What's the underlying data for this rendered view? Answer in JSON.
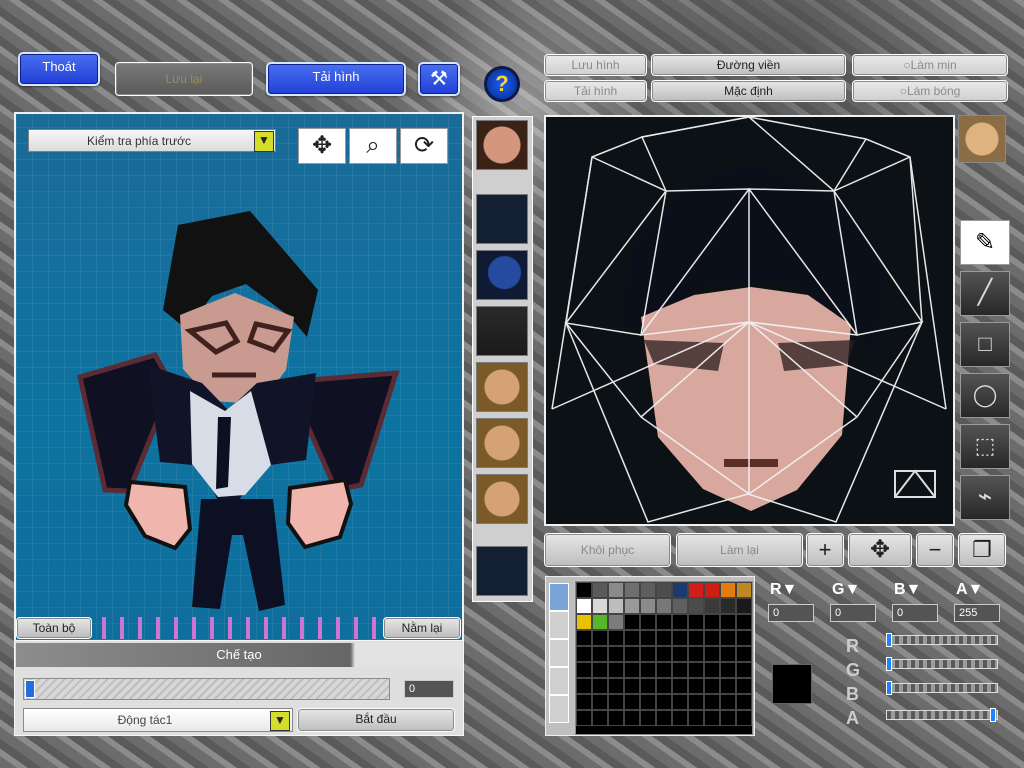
{
  "top_bar": {
    "exit_label": "Thoát",
    "save_label": "Lưu lại",
    "load_label": "Tải hình"
  },
  "editor_tabs": {
    "save_image": "Lưu hình",
    "load_image": "Tải hình",
    "outline": "Đường viền",
    "default": "Mặc định",
    "smooth": "Làm mịn",
    "shade": "Làm bóng"
  },
  "preview": {
    "view_mode": "Kiểm tra phía trước",
    "all_button": "Toàn bộ",
    "lie_button": "Nằm lại"
  },
  "creation": {
    "title": "Chế tạo",
    "value": "0",
    "motion": "Động tác1",
    "start": "Bắt đầu",
    "progress": 0.0
  },
  "editor_actions": {
    "restore": "Khôi phục",
    "redo": "Làm lại"
  },
  "color_controls": {
    "r_value": "0",
    "g_value": "0",
    "b_value": "0",
    "a_value": "255"
  },
  "palette_colors": [
    "#000000",
    "#5a5a5a",
    "#8a8a8a",
    "#6f6f6f",
    "#5e5e5e",
    "#4d4d4d",
    "#1b3970",
    "#d31d1d",
    "#ce1d13",
    "#e37c0d",
    "#be8822",
    "#ffffff",
    "#d9d9d9",
    "#bdbdbd",
    "#9a9a9a",
    "#8b8b8b",
    "#777777",
    "#5f5f5f",
    "#4c4c4c",
    "#3a3a3a",
    "#2a2a2a",
    "#1a1a1a",
    "#e8c200",
    "#56b528",
    "#7c7c7c",
    "#000000",
    "#000000",
    "#000000",
    "#000000",
    "#000000",
    "#000000",
    "#000000",
    "#000000"
  ]
}
